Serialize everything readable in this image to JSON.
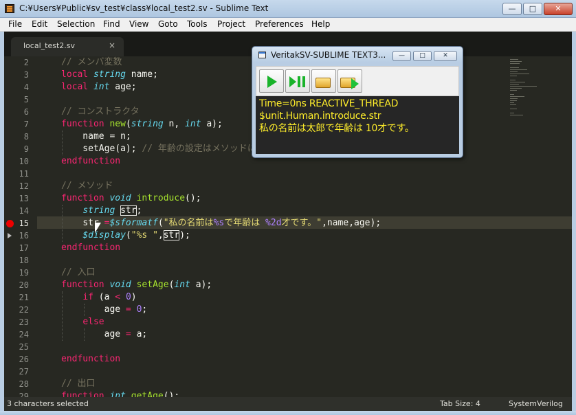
{
  "window": {
    "title": "C:¥Users¥Public¥sv_test¥class¥local_test2.sv - Sublime Text",
    "min_label": "—",
    "max_label": "□",
    "close_label": "✕"
  },
  "menu": [
    "File",
    "Edit",
    "Selection",
    "Find",
    "View",
    "Goto",
    "Tools",
    "Project",
    "Preferences",
    "Help"
  ],
  "tab": {
    "label": "local_test2.sv",
    "close_label": "×"
  },
  "editor": {
    "line_numbers": [
      "2",
      "3",
      "4",
      "5",
      "6",
      "7",
      "8",
      "9",
      "10",
      "11",
      "12",
      "13",
      "14",
      "15",
      "16",
      "17",
      "18",
      "19",
      "20",
      "21",
      "22",
      "23",
      "24",
      "25",
      "26",
      "27",
      "28",
      "29"
    ],
    "current_line": "15",
    "breakpoint_line": "15",
    "exec_line": "16",
    "code": [
      [
        {
          "t": "// メンバ変数",
          "c": "cm"
        }
      ],
      [
        {
          "t": "local ",
          "c": "kw"
        },
        {
          "t": "string",
          "c": "ty"
        },
        {
          "t": " name;",
          "c": ""
        }
      ],
      [
        {
          "t": "local ",
          "c": "kw"
        },
        {
          "t": "int",
          "c": "ty"
        },
        {
          "t": " age;",
          "c": ""
        }
      ],
      [],
      [
        {
          "t": "// コンストラクタ",
          "c": "cm"
        }
      ],
      [
        {
          "t": "function ",
          "c": "kw"
        },
        {
          "t": "new",
          "c": "fn"
        },
        {
          "t": "(",
          "c": ""
        },
        {
          "t": "string",
          "c": "ty"
        },
        {
          "t": " n, ",
          "c": ""
        },
        {
          "t": "int",
          "c": "ty"
        },
        {
          "t": " a);",
          "c": ""
        }
      ],
      [
        {
          "t": "    name = n;",
          "c": ""
        }
      ],
      [
        {
          "t": "    setAge(a); ",
          "c": ""
        },
        {
          "t": "// 年齢の設定はメソッドに任せる",
          "c": "cm"
        }
      ],
      [
        {
          "t": "endfunction",
          "c": "kw"
        }
      ],
      [],
      [
        {
          "t": "// メソッド",
          "c": "cm"
        }
      ],
      [
        {
          "t": "function ",
          "c": "kw"
        },
        {
          "t": "void ",
          "c": "ty"
        },
        {
          "t": "introduce",
          "c": "fn"
        },
        {
          "t": "();",
          "c": ""
        }
      ],
      [
        {
          "t": "    ",
          "c": ""
        },
        {
          "t": "string",
          "c": "ty"
        },
        {
          "t": " ",
          "c": ""
        },
        {
          "t": "str",
          "c": "box"
        },
        {
          "t": ";",
          "c": ""
        }
      ],
      [
        {
          "t": "    ",
          "c": ""
        },
        {
          "t": "str",
          "c": ""
        },
        {
          "t": " =",
          "c": "kw"
        },
        {
          "t": "$sformatf",
          "c": "ty"
        },
        {
          "t": "(",
          "c": ""
        },
        {
          "t": "\"私の名前は",
          "c": "st"
        },
        {
          "t": "%s",
          "c": "nu"
        },
        {
          "t": "で年齢は ",
          "c": "st"
        },
        {
          "t": "%2d",
          "c": "nu"
        },
        {
          "t": "才です。\"",
          "c": "st"
        },
        {
          "t": ",name,age);",
          "c": ""
        }
      ],
      [
        {
          "t": "    ",
          "c": ""
        },
        {
          "t": "$display",
          "c": "ty"
        },
        {
          "t": "(",
          "c": ""
        },
        {
          "t": "\"%s \"",
          "c": "st"
        },
        {
          "t": ",",
          "c": ""
        },
        {
          "t": "str",
          "c": "box"
        },
        {
          "t": ");",
          "c": ""
        }
      ],
      [
        {
          "t": "endfunction",
          "c": "kw"
        }
      ],
      [],
      [
        {
          "t": "// 入口",
          "c": "cm"
        }
      ],
      [
        {
          "t": "function ",
          "c": "kw"
        },
        {
          "t": "void ",
          "c": "ty"
        },
        {
          "t": "setAge",
          "c": "fn"
        },
        {
          "t": "(",
          "c": ""
        },
        {
          "t": "int",
          "c": "ty"
        },
        {
          "t": " a);",
          "c": ""
        }
      ],
      [
        {
          "t": "    ",
          "c": ""
        },
        {
          "t": "if",
          "c": "kw"
        },
        {
          "t": " (a ",
          "c": ""
        },
        {
          "t": "<",
          "c": "kw"
        },
        {
          "t": " ",
          "c": ""
        },
        {
          "t": "0",
          "c": "nu"
        },
        {
          "t": ")",
          "c": ""
        }
      ],
      [
        {
          "t": "        age ",
          "c": ""
        },
        {
          "t": "=",
          "c": "kw"
        },
        {
          "t": " ",
          "c": ""
        },
        {
          "t": "0",
          "c": "nu"
        },
        {
          "t": ";",
          "c": ""
        }
      ],
      [
        {
          "t": "    ",
          "c": ""
        },
        {
          "t": "else",
          "c": "kw"
        }
      ],
      [
        {
          "t": "        age ",
          "c": ""
        },
        {
          "t": "=",
          "c": "kw"
        },
        {
          "t": " a;",
          "c": ""
        }
      ],
      [],
      [
        {
          "t": "endfunction",
          "c": "kw"
        }
      ],
      [],
      [
        {
          "t": "// 出口",
          "c": "cm"
        }
      ],
      [
        {
          "t": "function ",
          "c": "kw"
        },
        {
          "t": "int ",
          "c": "ty"
        },
        {
          "t": "getAge",
          "c": "fn"
        },
        {
          "t": "();",
          "c": ""
        }
      ]
    ]
  },
  "status": {
    "selection": "3 characters selected",
    "tab_size": "Tab Size: 4",
    "syntax": "SystemVerilog"
  },
  "veritak": {
    "title": "VeritakSV-SUBLIME TEXT3...",
    "min_label": "—",
    "max_label": "□",
    "close_label": "✕",
    "console": [
      "Time=0ns REACTIVE_THREAD",
      "$unit.Human.introduce.str",
      "私の名前は太郎で年齢は 10才です。"
    ]
  }
}
